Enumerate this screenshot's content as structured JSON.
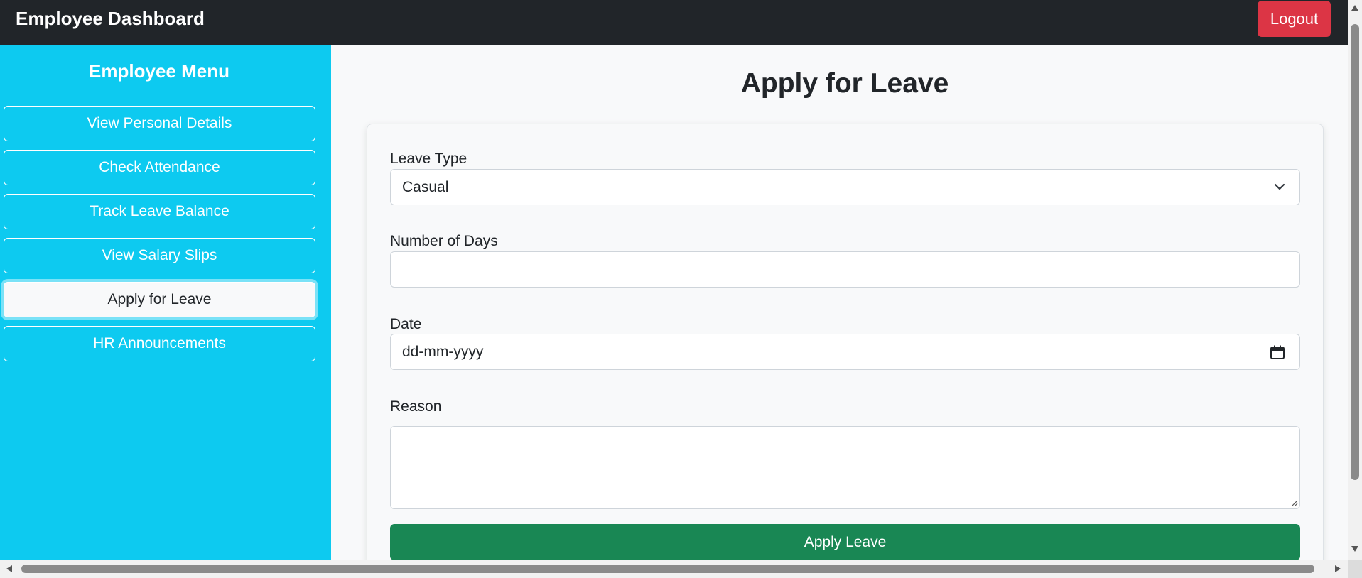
{
  "navbar": {
    "brand": "Employee Dashboard",
    "logout_label": "Logout",
    "logout_color": "#dc3545"
  },
  "sidebar": {
    "title": "Employee Menu",
    "color": "#0dcaf0",
    "items": [
      {
        "label": "View Personal Details"
      },
      {
        "label": "Check Attendance"
      },
      {
        "label": "Track Leave Balance"
      },
      {
        "label": "View Salary Slips"
      },
      {
        "label": "Apply for Leave",
        "active": true
      },
      {
        "label": "HR Announcements"
      }
    ]
  },
  "main": {
    "title": "Apply for Leave",
    "form": {
      "leave_type_label": "Leave Type",
      "leave_type_value": "Casual",
      "days_label": "Number of Days",
      "days_value": "",
      "date_label": "Date",
      "date_placeholder": "dd-mm-yyyy",
      "reason_label": "Reason",
      "reason_value": "",
      "submit_label": "Apply Leave",
      "submit_color": "#198754"
    }
  },
  "icons": {
    "select_arrow": "chevron-down-icon",
    "date_picker": "calendar-icon"
  }
}
